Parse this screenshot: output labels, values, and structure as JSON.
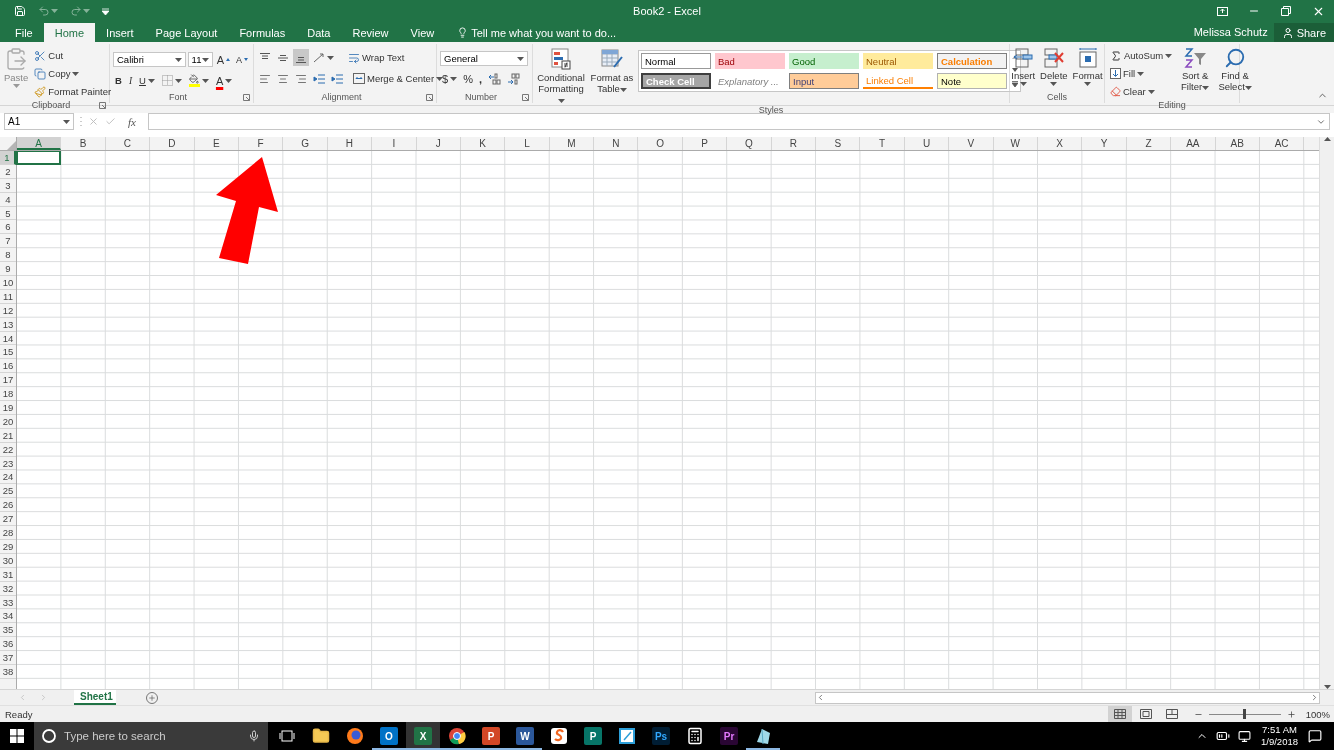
{
  "title_bar": {
    "title": "Book2 - Excel",
    "quick_access": [
      {
        "kind": "save",
        "disabled": false
      },
      {
        "kind": "undo",
        "disabled": true
      },
      {
        "kind": "redo",
        "disabled": true
      },
      {
        "kind": "customize",
        "disabled": false
      }
    ]
  },
  "tabs": [
    {
      "label": "File",
      "selected": false
    },
    {
      "label": "Home",
      "selected": true
    },
    {
      "label": "Insert",
      "selected": false
    },
    {
      "label": "Page Layout",
      "selected": false
    },
    {
      "label": "Formulas",
      "selected": false
    },
    {
      "label": "Data",
      "selected": false
    },
    {
      "label": "Review",
      "selected": false
    },
    {
      "label": "View",
      "selected": false
    }
  ],
  "tell_me": "Tell me what you want to do...",
  "account": {
    "user": "Melissa Schutz",
    "share": "Share"
  },
  "clipboard": {
    "label": "Clipboard",
    "paste": "Paste",
    "cut": "Cut",
    "copy": "Copy",
    "format_painter": "Format Painter"
  },
  "font": {
    "label": "Font",
    "name": "Calibri",
    "size": "11",
    "grow": "A",
    "shrink": "A",
    "bold": "B",
    "italic": "I",
    "underline": "U",
    "font_color": "A"
  },
  "alignment": {
    "label": "Alignment",
    "vertical": [
      {
        "kind": "top",
        "selected": false
      },
      {
        "kind": "middle",
        "selected": false
      },
      {
        "kind": "bottom",
        "selected": true
      }
    ],
    "wrap_text": "Wrap Text",
    "merge": "Merge & Center"
  },
  "number": {
    "label": "Number",
    "format": "General",
    "currency": "$",
    "percent": "%",
    "comma": ","
  },
  "styles": {
    "label": "Styles",
    "conditional": "Conditional Formatting",
    "format_table": "Format as Table",
    "cells": [
      {
        "kind": "normal",
        "label": "Normal"
      },
      {
        "kind": "bad",
        "label": "Bad"
      },
      {
        "kind": "good",
        "label": "Good"
      },
      {
        "kind": "neutral",
        "label": "Neutral"
      },
      {
        "kind": "calculation",
        "label": "Calculation"
      },
      {
        "kind": "check",
        "label": "Check Cell"
      },
      {
        "kind": "explanatory",
        "label": "Explanatory ..."
      },
      {
        "kind": "input",
        "label": "Input"
      },
      {
        "kind": "linked",
        "label": "Linked Cell"
      },
      {
        "kind": "note",
        "label": "Note"
      }
    ]
  },
  "cells_group": {
    "label": "Cells",
    "buttons": [
      {
        "kind": "insert",
        "label": "Insert"
      },
      {
        "kind": "delete",
        "label": "Delete"
      },
      {
        "kind": "format",
        "label": "Format"
      }
    ]
  },
  "editing": {
    "label": "Editing",
    "autosum": "AutoSum",
    "fill": "Fill",
    "clear": "Clear",
    "sort": "Sort & Filter",
    "find": "Find & Select"
  },
  "formula_bar": {
    "name_box": "A1",
    "function": "fx"
  },
  "columns": [
    {
      "label": "A",
      "selected": true
    },
    {
      "label": "B",
      "selected": false
    },
    {
      "label": "C",
      "selected": false
    },
    {
      "label": "D",
      "selected": false
    },
    {
      "label": "E",
      "selected": false
    },
    {
      "label": "F",
      "selected": false
    },
    {
      "label": "G",
      "selected": false
    },
    {
      "label": "H",
      "selected": false
    },
    {
      "label": "I",
      "selected": false
    },
    {
      "label": "J",
      "selected": false
    },
    {
      "label": "K",
      "selected": false
    },
    {
      "label": "L",
      "selected": false
    },
    {
      "label": "M",
      "selected": false
    },
    {
      "label": "N",
      "selected": false
    },
    {
      "label": "O",
      "selected": false
    },
    {
      "label": "P",
      "selected": false
    },
    {
      "label": "Q",
      "selected": false
    },
    {
      "label": "R",
      "selected": false
    },
    {
      "label": "S",
      "selected": false
    },
    {
      "label": "T",
      "selected": false
    },
    {
      "label": "U",
      "selected": false
    },
    {
      "label": "V",
      "selected": false
    },
    {
      "label": "W",
      "selected": false
    },
    {
      "label": "X",
      "selected": false
    },
    {
      "label": "Y",
      "selected": false
    },
    {
      "label": "Z",
      "selected": false
    },
    {
      "label": "AA",
      "selected": false
    },
    {
      "label": "AB",
      "selected": false
    },
    {
      "label": "AC",
      "selected": false
    }
  ],
  "rows": [
    {
      "label": "1",
      "selected": true
    },
    {
      "label": "2",
      "selected": false
    },
    {
      "label": "3",
      "selected": false
    },
    {
      "label": "4",
      "selected": false
    },
    {
      "label": "5",
      "selected": false
    },
    {
      "label": "6",
      "selected": false
    },
    {
      "label": "7",
      "selected": false
    },
    {
      "label": "8",
      "selected": false
    },
    {
      "label": "9",
      "selected": false
    },
    {
      "label": "10",
      "selected": false
    },
    {
      "label": "11",
      "selected": false
    },
    {
      "label": "12",
      "selected": false
    },
    {
      "label": "13",
      "selected": false
    },
    {
      "label": "14",
      "selected": false
    },
    {
      "label": "15",
      "selected": false
    },
    {
      "label": "16",
      "selected": false
    },
    {
      "label": "17",
      "selected": false
    },
    {
      "label": "18",
      "selected": false
    },
    {
      "label": "19",
      "selected": false
    },
    {
      "label": "20",
      "selected": false
    },
    {
      "label": "21",
      "selected": false
    },
    {
      "label": "22",
      "selected": false
    },
    {
      "label": "23",
      "selected": false
    },
    {
      "label": "24",
      "selected": false
    },
    {
      "label": "25",
      "selected": false
    },
    {
      "label": "26",
      "selected": false
    },
    {
      "label": "27",
      "selected": false
    },
    {
      "label": "28",
      "selected": false
    },
    {
      "label": "29",
      "selected": false
    },
    {
      "label": "30",
      "selected": false
    },
    {
      "label": "31",
      "selected": false
    },
    {
      "label": "32",
      "selected": false
    },
    {
      "label": "33",
      "selected": false
    },
    {
      "label": "34",
      "selected": false
    },
    {
      "label": "35",
      "selected": false
    },
    {
      "label": "36",
      "selected": false
    },
    {
      "label": "37",
      "selected": false
    },
    {
      "label": "38",
      "selected": false
    }
  ],
  "sheets": [
    {
      "label": "Sheet1",
      "selected": true
    }
  ],
  "status_bar": {
    "status": "Ready",
    "views": [
      {
        "kind": "normal",
        "selected": true
      },
      {
        "kind": "page_layout",
        "selected": false
      },
      {
        "kind": "page_break",
        "selected": false
      }
    ],
    "zoom": {
      "level": 0.5,
      "label": "100%"
    }
  },
  "taskbar": {
    "search_placeholder": "Type here to search",
    "apps": [
      {
        "kind": "folder",
        "running": false,
        "selected": false
      },
      {
        "kind": "firefox",
        "running": false,
        "selected": false
      },
      {
        "kind": "outlook",
        "glyph": "O",
        "running": true,
        "selected": false
      },
      {
        "kind": "excel",
        "glyph": "X",
        "running": true,
        "selected": true
      },
      {
        "kind": "chrome",
        "running": true,
        "selected": false
      },
      {
        "kind": "powerpoint",
        "glyph": "P",
        "running": true,
        "selected": false
      },
      {
        "kind": "word",
        "glyph": "W",
        "running": true,
        "selected": false
      },
      {
        "kind": "snagit",
        "running": false,
        "selected": false
      },
      {
        "kind": "publisher",
        "glyph": "P",
        "running": false,
        "selected": false
      },
      {
        "kind": "notes",
        "running": false,
        "selected": false
      },
      {
        "kind": "photoshop",
        "glyph": "Ps",
        "running": false,
        "selected": false
      },
      {
        "kind": "calculator",
        "running": false,
        "selected": false
      },
      {
        "kind": "premiere",
        "glyph": "Pr",
        "running": false,
        "selected": false
      },
      {
        "kind": "crystal",
        "running": true,
        "selected": false
      }
    ],
    "time": "7:51 AM",
    "date": "1/9/2018"
  }
}
